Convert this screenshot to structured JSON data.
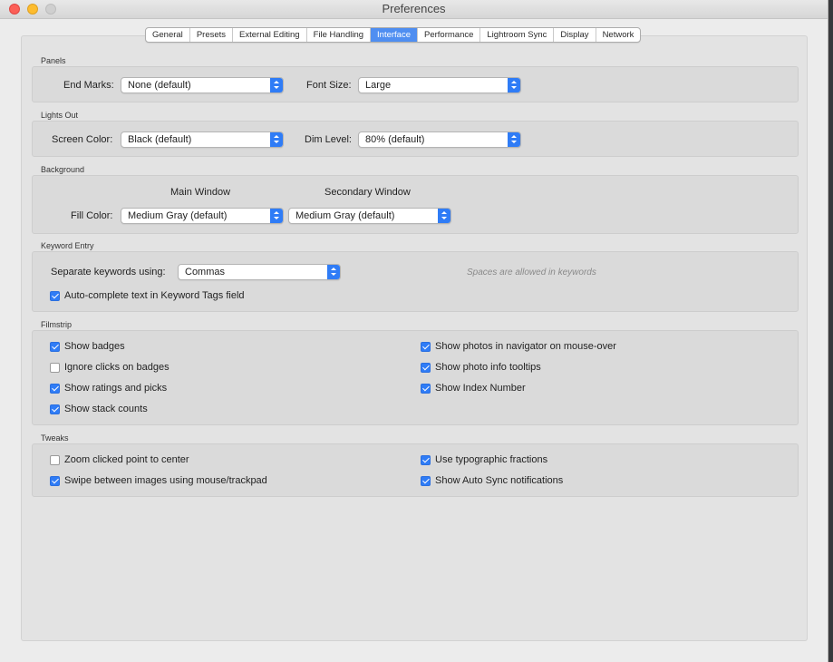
{
  "window": {
    "title": "Preferences"
  },
  "tabs": [
    {
      "label": "General"
    },
    {
      "label": "Presets"
    },
    {
      "label": "External Editing"
    },
    {
      "label": "File Handling"
    },
    {
      "label": "Interface",
      "active": true
    },
    {
      "label": "Performance"
    },
    {
      "label": "Lightroom Sync"
    },
    {
      "label": "Display"
    },
    {
      "label": "Network"
    }
  ],
  "panels": {
    "heading": "Panels",
    "end_marks_label": "End Marks:",
    "end_marks_value": "None (default)",
    "font_size_label": "Font Size:",
    "font_size_value": "Large"
  },
  "lights_out": {
    "heading": "Lights Out",
    "screen_color_label": "Screen Color:",
    "screen_color_value": "Black (default)",
    "dim_level_label": "Dim Level:",
    "dim_level_value": "80% (default)"
  },
  "background": {
    "heading": "Background",
    "main_window_label": "Main Window",
    "secondary_window_label": "Secondary Window",
    "fill_color_label": "Fill Color:",
    "main_fill_value": "Medium Gray (default)",
    "secondary_fill_value": "Medium Gray (default)"
  },
  "keyword_entry": {
    "heading": "Keyword Entry",
    "separate_label": "Separate keywords using:",
    "separate_value": "Commas",
    "hint": "Spaces are allowed in keywords",
    "autocomplete_label": "Auto-complete text in Keyword Tags field",
    "autocomplete_checked": true
  },
  "filmstrip": {
    "heading": "Filmstrip",
    "left": [
      {
        "label": "Show badges",
        "checked": true
      },
      {
        "label": "Ignore clicks on badges",
        "checked": false
      },
      {
        "label": "Show ratings and picks",
        "checked": true
      },
      {
        "label": "Show stack counts",
        "checked": true
      }
    ],
    "right": [
      {
        "label": "Show photos in navigator on mouse-over",
        "checked": true
      },
      {
        "label": "Show photo info tooltips",
        "checked": true
      },
      {
        "label": "Show Index Number",
        "checked": true
      }
    ]
  },
  "tweaks": {
    "heading": "Tweaks",
    "left": [
      {
        "label": "Zoom clicked point to center",
        "checked": false
      },
      {
        "label": "Swipe between images using mouse/trackpad",
        "checked": true
      }
    ],
    "right": [
      {
        "label": "Use typographic fractions",
        "checked": true
      },
      {
        "label": "Show Auto Sync notifications",
        "checked": true
      }
    ]
  },
  "colors": {
    "accent": "#2f7cf6",
    "active_tab": "#4f8ef1"
  }
}
